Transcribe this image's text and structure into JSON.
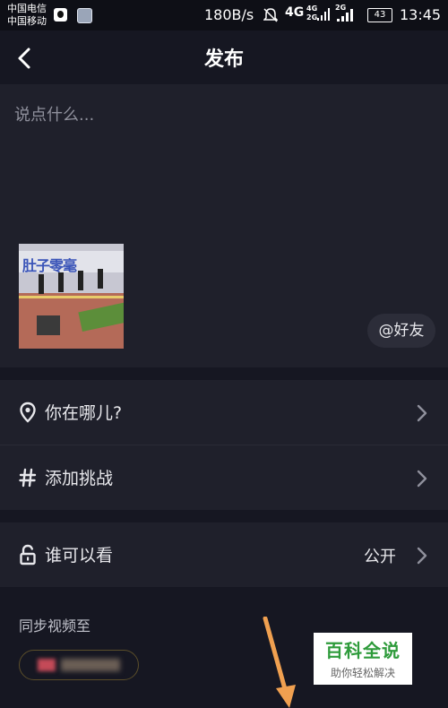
{
  "status_bar": {
    "carrier_1": "中国电信",
    "carrier_2": "中国移动",
    "net_speed": "180B/s",
    "network": "4G",
    "signal_1": "4G",
    "signal_2": "2G",
    "battery": "43",
    "time": "13:45"
  },
  "header": {
    "title": "发布",
    "back_icon": "chevron-left-icon"
  },
  "compose": {
    "caption_placeholder": "说点什么...",
    "thumbnail_banner_text": "肚子零毫",
    "mention_button": "@好友"
  },
  "options": [
    {
      "icon": "location-pin-icon",
      "label": "你在哪儿?",
      "value": ""
    },
    {
      "icon": "hashtag-icon",
      "label": "添加挑战",
      "value": ""
    },
    {
      "icon": "unlock-icon",
      "label": "谁可以看",
      "value": "公开"
    }
  ],
  "sync": {
    "title": "同步视频至"
  },
  "watermark": {
    "title": "百科全说",
    "subtitle": "助你轻松解决"
  },
  "colors": {
    "background": "#161722",
    "panel": "#1f202b",
    "annotation_arrow": "#f0a050",
    "watermark_green": "#2e9b3b"
  }
}
